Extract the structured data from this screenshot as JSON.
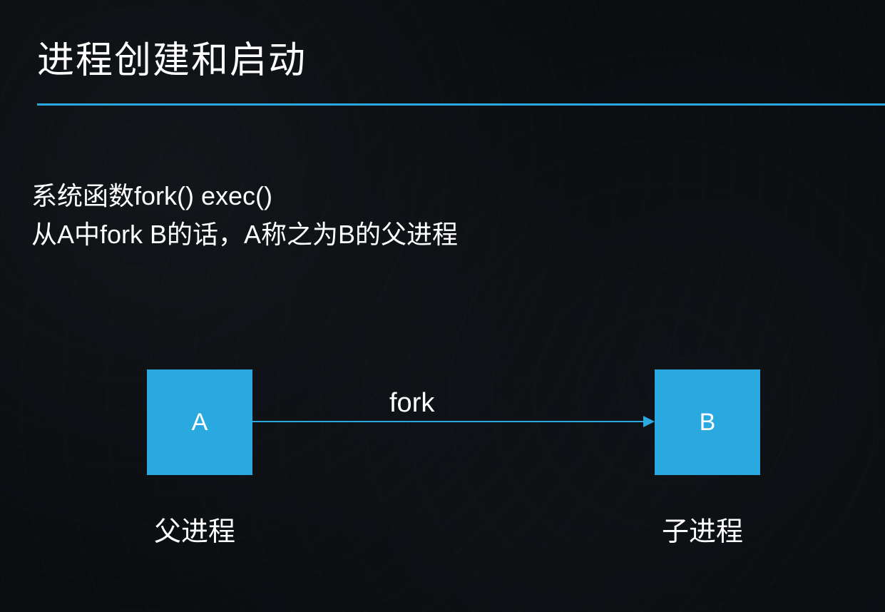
{
  "title": "进程创建和启动",
  "body": {
    "line1": "系统函数fork() exec()",
    "line2": "从A中fork B的话，A称之为B的父进程"
  },
  "diagram": {
    "boxA": {
      "letter": "A",
      "label": "父进程"
    },
    "boxB": {
      "letter": "B",
      "label": "子进程"
    },
    "arrowLabel": "fork"
  },
  "colors": {
    "accent": "#2aa9e0",
    "background": "#0a0d10",
    "text": "#ffffff"
  }
}
